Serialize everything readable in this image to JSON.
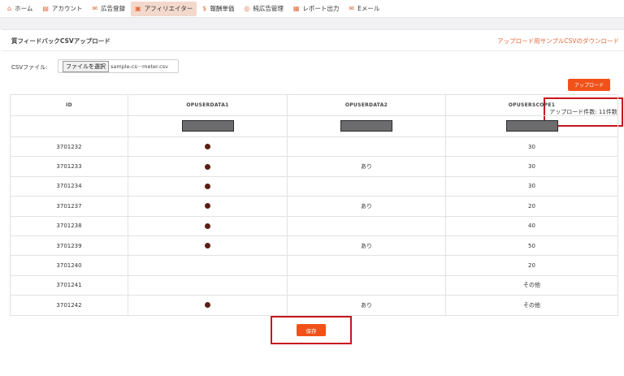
{
  "nav": {
    "items": [
      {
        "icon": "home-icon",
        "glyph": "⌂",
        "label": "ホーム"
      },
      {
        "icon": "account-icon",
        "glyph": "▤",
        "label": "アカウント"
      },
      {
        "icon": "megaphone-icon",
        "glyph": "✉",
        "label": "広告登録"
      },
      {
        "icon": "affiliate-icon",
        "glyph": "▣",
        "label": "アフィリエイター"
      },
      {
        "icon": "dollar-icon",
        "glyph": "$",
        "label": "報酬単価"
      },
      {
        "icon": "ad-manage-icon",
        "glyph": "◎",
        "label": "純広告管理"
      },
      {
        "icon": "report-icon",
        "glyph": "▦",
        "label": "レポート出力"
      },
      {
        "icon": "mail-icon",
        "glyph": "✉",
        "label": "Eメール"
      }
    ],
    "active_index": 3
  },
  "page": {
    "title": "質フィードバックCSVアップロード",
    "sample_link": "アップロード用サンプルCSVのダウンロード",
    "csv_label": "CSVファイル:",
    "file_button": "ファイルを選択",
    "file_name": "sample-cs···meter.csv",
    "upload_button": "アップロード",
    "upload_count": "アップロード件数: 11件数",
    "save_button": "保存"
  },
  "table": {
    "headers": [
      "ID",
      "OPUSERDATA1",
      "OPUSERDATA2",
      "OPUSERSCOPE1"
    ],
    "rows": [
      {
        "id": "3701232",
        "data1": true,
        "data2": "",
        "scope": "30"
      },
      {
        "id": "3701233",
        "data1": true,
        "data2": "あり",
        "scope": "30"
      },
      {
        "id": "3701234",
        "data1": true,
        "data2": "",
        "scope": "30"
      },
      {
        "id": "3701237",
        "data1": true,
        "data2": "あり",
        "scope": "20"
      },
      {
        "id": "3701238",
        "data1": true,
        "data2": "",
        "scope": "40"
      },
      {
        "id": "3701239",
        "data1": true,
        "data2": "あり",
        "scope": "50"
      },
      {
        "id": "3701240",
        "data1": false,
        "data2": "",
        "scope": "20"
      },
      {
        "id": "3701241",
        "data1": false,
        "data2": "",
        "scope": "その他"
      },
      {
        "id": "3701242",
        "data1": true,
        "data2": "あり",
        "scope": "その他"
      }
    ]
  },
  "colors": {
    "accent": "#f0521a",
    "highlight_border": "#c8161d",
    "dot": "#5a2014"
  }
}
